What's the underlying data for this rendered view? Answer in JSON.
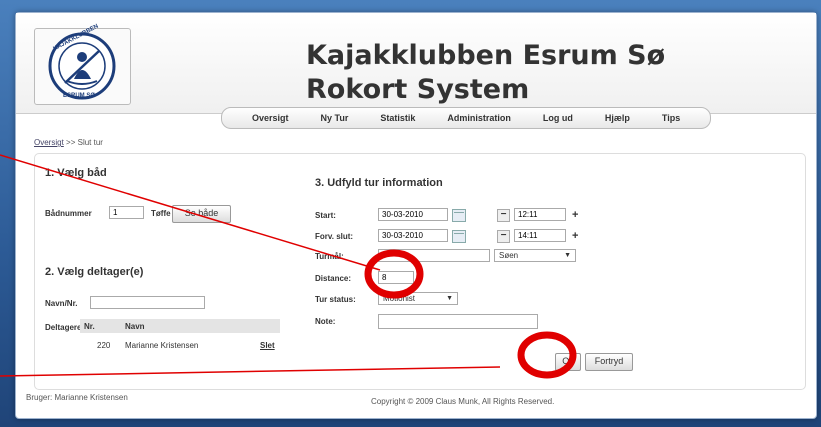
{
  "header": {
    "title_line1": "Kajakklubben Esrum Sø",
    "title_line2": "Rokort System",
    "logo_text_top": "KAJAKKLUBBEN",
    "logo_text_bottom": "ESRUM SØ"
  },
  "nav": [
    "Oversigt",
    "Ny Tur",
    "Statistik",
    "Administration",
    "Log ud",
    "Hjælp",
    "Tips"
  ],
  "breadcrumb": {
    "link": "Oversigt",
    "sep": ">>",
    "current": "Slut tur"
  },
  "section1": {
    "heading": "1. Vælg båd",
    "boat_label": "Bådnummer",
    "boat_value": "1",
    "boat_name": "Tøffe",
    "show_boats_button": "Se både"
  },
  "section2": {
    "heading": "2. Vælg deltager(e)",
    "name_label": "Navn/Nr.",
    "name_value": "",
    "participants_label": "Deltagere",
    "col_nr": "Nr.",
    "col_name": "Navn",
    "rows": [
      {
        "nr": "220",
        "name": "Marianne Kristensen",
        "action": "Slet"
      }
    ]
  },
  "section3": {
    "heading": "3. Udfyld tur information",
    "start_label": "Start:",
    "start_date": "30-03-2010",
    "start_time": "12:11",
    "end_label": "Forv. slut:",
    "end_date": "30-03-2010",
    "end_time": "14:11",
    "destination_label": "Turmål:",
    "destination_value": "",
    "destination_select": "Søen",
    "distance_label": "Distance:",
    "distance_value": "8",
    "status_label": "Tur status:",
    "status_value": "Motionist",
    "note_label": "Note:",
    "note_value": "",
    "ok_button": "Ok",
    "cancel_button": "Fortryd",
    "minus": "−",
    "plus": "+"
  },
  "footer": {
    "user": "Bruger: Marianne Kristensen",
    "copyright": "Copyright © 2009 Claus Munk, All Rights Reserved."
  },
  "colors": {
    "annotation": "#e00000",
    "background": "#2f5f9c"
  }
}
